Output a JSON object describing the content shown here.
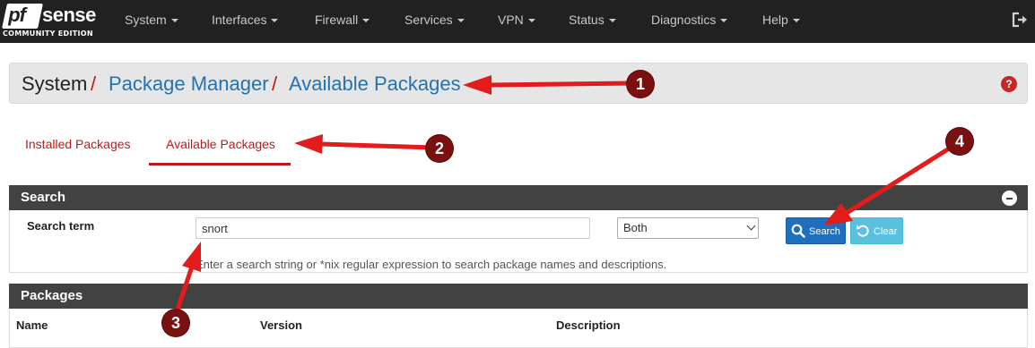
{
  "logo": {
    "pf": "pf",
    "sense": "sense",
    "edition": "COMMUNITY EDITION"
  },
  "nav": {
    "items": [
      {
        "label": "System"
      },
      {
        "label": "Interfaces"
      },
      {
        "label": "Firewall"
      },
      {
        "label": "Services"
      },
      {
        "label": "VPN"
      },
      {
        "label": "Status"
      },
      {
        "label": "Diagnostics"
      },
      {
        "label": "Help"
      }
    ],
    "logout_icon": "sign-out-icon"
  },
  "breadcrumb": {
    "root": "System",
    "separator": "/",
    "crumb1": "Package Manager",
    "crumb2": "Available Packages",
    "help_icon": "question-icon",
    "help_symbol": "?"
  },
  "tabs": [
    {
      "label": "Installed Packages",
      "active": false
    },
    {
      "label": "Available Packages",
      "active": true
    }
  ],
  "search_panel": {
    "title": "Search",
    "term_label": "Search term",
    "term_value": "snort",
    "type_selected": "Both",
    "search_button": "Search",
    "clear_button": "Clear",
    "hint": "Enter a search string or *nix regular expression to search package names and descriptions."
  },
  "packages_panel": {
    "title": "Packages",
    "columns": [
      "Name",
      "Version",
      "Description"
    ]
  },
  "annotations": [
    "1",
    "2",
    "3",
    "4"
  ],
  "colors": {
    "navbar": "#212121",
    "accent_red": "#b71c1c",
    "link_blue": "#2672b0",
    "panel_head": "#424242",
    "btn_primary": "#1e6fbd",
    "btn_info": "#5bc0de",
    "annotation_arrow": "#e31b1b",
    "annotation_badge": "#7a1010"
  }
}
